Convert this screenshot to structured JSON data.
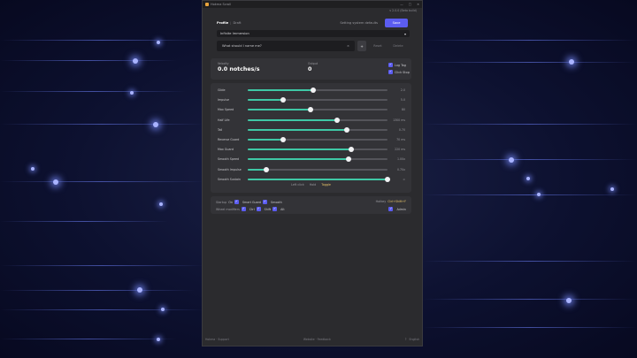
{
  "window": {
    "title": "Hokma Scroll",
    "subtitle": "v 2.0.0 (Beta build)",
    "controls": [
      "—",
      "□",
      "✕"
    ]
  },
  "header": {
    "tab_profile": "Profile",
    "tab_separator": "|",
    "tab_draft": "Draft",
    "system_defaults": "Setting system defaults",
    "save_label": "Save"
  },
  "preset": {
    "selected": "Infinite Immersion",
    "chevron": "▾"
  },
  "name_field": {
    "placeholder": "What should I name me?",
    "clear": "×",
    "add": "+",
    "reset": "Reset",
    "delete": "Delete"
  },
  "stats": {
    "velocity_label": "Velocity",
    "velocity_value": "0.0 notches/s",
    "output_label": "Output",
    "output_value": "0",
    "toggles": [
      {
        "label": "Log Tag",
        "checked": true
      },
      {
        "label": "Click Stop",
        "checked": true
      }
    ]
  },
  "sliders": [
    {
      "name": "Glide",
      "value": "2.0",
      "fraction": 0.47
    },
    {
      "name": "Impulse",
      "value": "5.0",
      "fraction": 0.25
    },
    {
      "name": "Max Speed",
      "value": "80",
      "fraction": 0.45
    },
    {
      "name": "Half Life",
      "value": "1300 ms",
      "fraction": 0.64
    },
    {
      "name": "Tail",
      "value": "0.70",
      "fraction": 0.71
    },
    {
      "name": "Reverse Guard",
      "value": "70 ms",
      "fraction": 0.25
    },
    {
      "name": "Max Guard",
      "value": "220 ms",
      "fraction": 0.74
    },
    {
      "name": "Smooth Speed",
      "value": "1.00x",
      "fraction": 0.72
    },
    {
      "name": "Smooth Impulse",
      "value": "0.70x",
      "fraction": 0.13
    },
    {
      "name": "Smooth Sustain",
      "value": "∞",
      "fraction": 1.0
    }
  ],
  "mode": {
    "left_click": "Left click",
    "hold": "Hold",
    "toggle": "Toggle"
  },
  "footer": {
    "startup_label": "Startup",
    "startup_value": "On",
    "smart_guard": "Smart Guard",
    "smooth": "Smooth",
    "hotkey_label": "Hotkey",
    "hotkey_value": "Ctrl+Shift+F",
    "wheel_modifiers_label": "Wheel modifiers",
    "mod_ctrl": "Ctrl",
    "mod_shift": "Shift",
    "mod_alt": "Alt",
    "admin": "Admin"
  },
  "bottom": {
    "left": "Hokma · Support",
    "center": "Website · Feedback",
    "right_icon": "?",
    "language": "English"
  }
}
